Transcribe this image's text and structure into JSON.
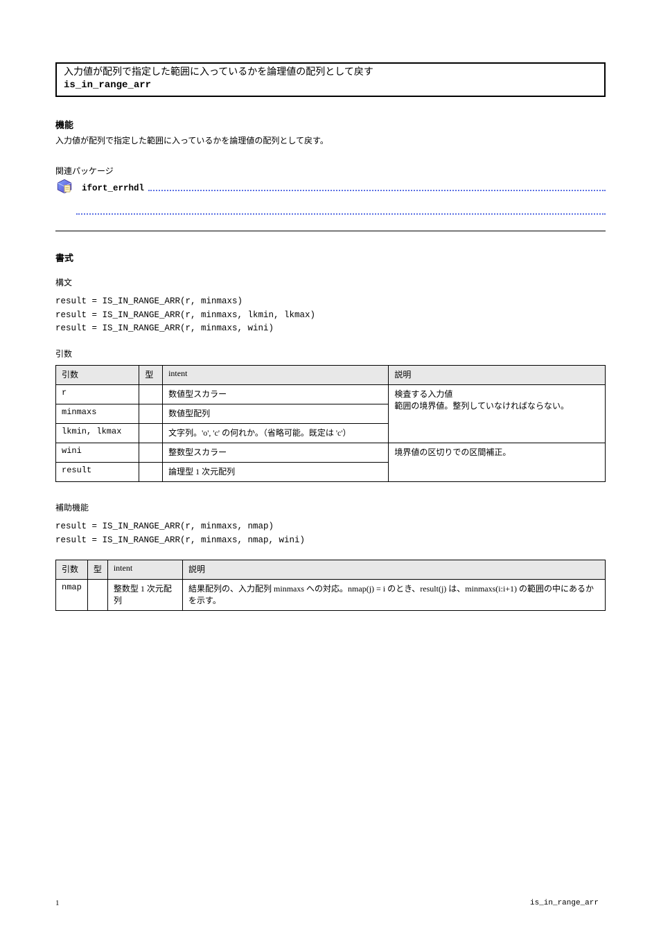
{
  "title": {
    "jp": "入力値が配列で指定した範囲に入っているかを論理値の配列として戻す",
    "fn": "is_in_range_arr"
  },
  "section1": {
    "heading": "機能",
    "text": "入力値が配列で指定した範囲に入っているかを論理値の配列として戻す。"
  },
  "relpackages": {
    "heading": "関連パッケージ",
    "item_name": "ifort_errhdl"
  },
  "section2": {
    "heading": "書式",
    "sub1": {
      "label": "構文",
      "lines": [
        "result = IS_IN_RANGE_ARR(r, minmaxs)",
        "result = IS_IN_RANGE_ARR(r, minmaxs, lkmin, lkmax)",
        "result = IS_IN_RANGE_ARR(r, minmaxs, wini)"
      ]
    },
    "args": {
      "label": "引数",
      "headers": [
        "引数",
        "型",
        "intent",
        "説明"
      ],
      "rows": [
        {
          "name": "r",
          "type": "",
          "intent": "数値型スカラー",
          "desc": "検査する入力値"
        },
        {
          "name": "minmaxs",
          "type": "",
          "intent": "数値型配列",
          "desc": "範囲の境界値。整列していなければならない。",
          "descRowSpan": 3
        },
        {
          "name": "lkmin, lkmax",
          "type": "",
          "intent": "文字列。'o', 'c' の何れか。（省略可能。既定は 'c'）",
          "desc": ""
        },
        {
          "name": "wini",
          "type": "",
          "intent": "整数型スカラー",
          "desc": "境界値の区切りでの区間補正。"
        },
        {
          "name": "result",
          "type": "",
          "intent": "論理型 1 次元配列",
          "desc": ""
        }
      ]
    },
    "sub2": {
      "label": "補助機能",
      "aux_lines": [
        "result = IS_IN_RANGE_ARR(r, minmaxs, nmap)",
        "result = IS_IN_RANGE_ARR(r, minmaxs, nmap, wini)"
      ]
    },
    "auxargs": {
      "headers": [
        "引数",
        "型",
        "intent",
        "説明"
      ],
      "rows": [
        {
          "name": "nmap",
          "type": "",
          "intent": "整数型 1 次元配列",
          "desc": "結果配列の、入力配列 minmaxs への対応。nmap(j) = i のとき、result(j) は、minmaxs(i:i+1) の範囲の中にあるかを示す。"
        }
      ]
    }
  },
  "footer": {
    "left": "1",
    "right": "is_in_range_arr"
  }
}
